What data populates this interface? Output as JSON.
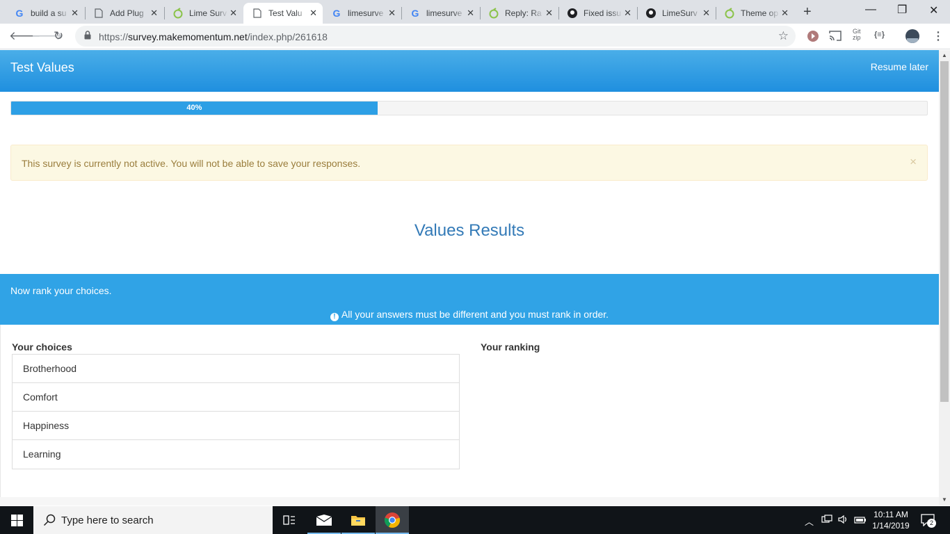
{
  "browser": {
    "tabs": [
      {
        "title": "build a su",
        "icon": "google-icon"
      },
      {
        "title": "Add Plug",
        "icon": "page-icon"
      },
      {
        "title": "Lime Surv",
        "icon": "limesurvey-icon"
      },
      {
        "title": "Test Valu",
        "icon": "page-icon",
        "active": true
      },
      {
        "title": "limesurve",
        "icon": "google-icon"
      },
      {
        "title": "limesurve",
        "icon": "google-icon"
      },
      {
        "title": "Reply: Ra",
        "icon": "limesurvey-icon"
      },
      {
        "title": "Fixed issu",
        "icon": "github-icon"
      },
      {
        "title": "LimeSurv",
        "icon": "github-icon"
      },
      {
        "title": "Theme op",
        "icon": "limesurvey-icon"
      }
    ],
    "url_prefix": "https://",
    "url_host": "survey.makemomentum.net",
    "url_path": "/index.php/261618"
  },
  "survey": {
    "title": "Test Values",
    "resume_label": "Resume later",
    "progress_label": "40%",
    "progress_value": 0.4,
    "alert_message": "This survey is currently not active. You will not be able to save your responses.",
    "alert_close": "×",
    "group_title": "Values Results",
    "question_text": "Now rank your choices.",
    "question_tip": "All your answers must be different and you must rank in order.",
    "choices_header": "Your choices",
    "ranking_header": "Your ranking",
    "choices": [
      "Brotherhood",
      "Comfort",
      "Happiness",
      "Learning"
    ]
  },
  "taskbar": {
    "search_placeholder": "Type here to search",
    "time": "10:11 AM",
    "date": "1/14/2019",
    "notification_count": "2"
  },
  "colors": {
    "header_blue": "#1f8fdf",
    "question_blue": "#30a3e6",
    "title_blue": "#337ab7",
    "alert_bg": "#fcf8e3"
  }
}
